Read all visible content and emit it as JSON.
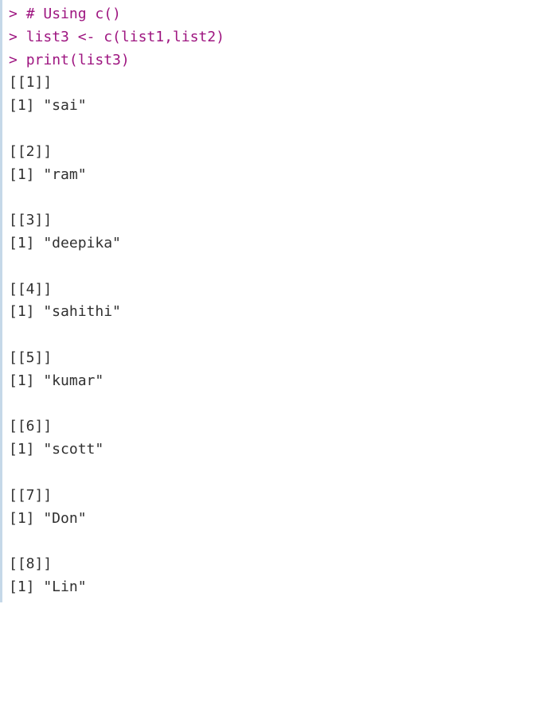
{
  "console": {
    "input_lines": [
      {
        "prompt": ">",
        "tokens": [
          "# Using c()"
        ]
      },
      {
        "prompt": ">",
        "tokens": [
          "list3 <- c(list1,list2)"
        ]
      },
      {
        "prompt": ">",
        "tokens": [
          "print(list3)"
        ]
      }
    ],
    "output_items": [
      {
        "index": "[[1]]",
        "value": "[1] \"sai\""
      },
      {
        "index": "[[2]]",
        "value": "[1] \"ram\""
      },
      {
        "index": "[[3]]",
        "value": "[1] \"deepika\""
      },
      {
        "index": "[[4]]",
        "value": "[1] \"sahithi\""
      },
      {
        "index": "[[5]]",
        "value": "[1] \"kumar\""
      },
      {
        "index": "[[6]]",
        "value": "[1] \"scott\""
      },
      {
        "index": "[[7]]",
        "value": "[1] \"Don\""
      },
      {
        "index": "[[8]]",
        "value": "[1] \"Lin\""
      }
    ]
  }
}
